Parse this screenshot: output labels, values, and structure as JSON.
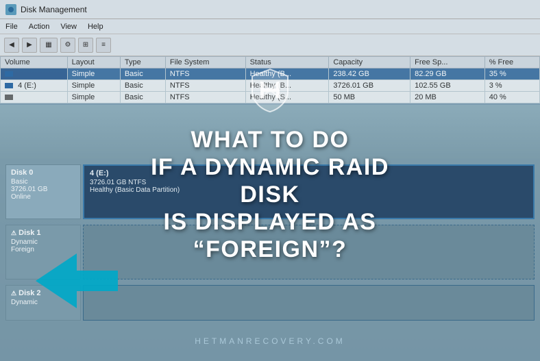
{
  "window": {
    "title": "Disk Management",
    "menu": [
      "File",
      "Action",
      "View",
      "Help"
    ]
  },
  "table": {
    "headers": [
      "Volume",
      "Layout",
      "Type",
      "File System",
      "Status",
      "Capacity",
      "Free Sp...",
      "% Free"
    ],
    "rows": [
      {
        "volume": "",
        "layout": "Simple",
        "type": "Basic",
        "fs": "NTFS",
        "status": "Healthy (B...",
        "capacity": "238.42 GB",
        "free": "82.29 GB",
        "pctfree": "35 %"
      },
      {
        "volume": "4 (E:)",
        "layout": "Simple",
        "type": "Basic",
        "fs": "NTFS",
        "status": "Healthy (B...",
        "capacity": "3726.01 GB",
        "free": "102.55 GB",
        "pctfree": "3 %"
      },
      {
        "volume": "",
        "layout": "Simple",
        "type": "Basic",
        "fs": "NTFS",
        "status": "Healthy (S...",
        "capacity": "50 MB",
        "free": "20 MB",
        "pctfree": "40 %"
      }
    ]
  },
  "disks": [
    {
      "id": "Disk 0",
      "type": "Basic",
      "size": "3726.01 GB",
      "status": "Online",
      "partition": {
        "name": "4  (E:)",
        "details": "3726.01 GB NTFS",
        "health": "Healthy (Basic Data Partition)"
      }
    },
    {
      "id": "Disk 1",
      "type": "Dynamic",
      "size": "",
      "status": "Foreign",
      "partition": null
    },
    {
      "id": "Disk 2",
      "type": "Dynamic",
      "size": "",
      "status": "",
      "partition": null
    }
  ],
  "overlay": {
    "title_line1": "WHAT TO DO",
    "title_line2": "IF A DYNAMIC RAID DISK",
    "title_line3": "IS DISPLAYED AS “FOREIGN”?",
    "domain": "HETMANRECOVERY.COM"
  },
  "logo": {
    "shape": "shield",
    "color": "#ffffff",
    "opacity": 0.9
  }
}
